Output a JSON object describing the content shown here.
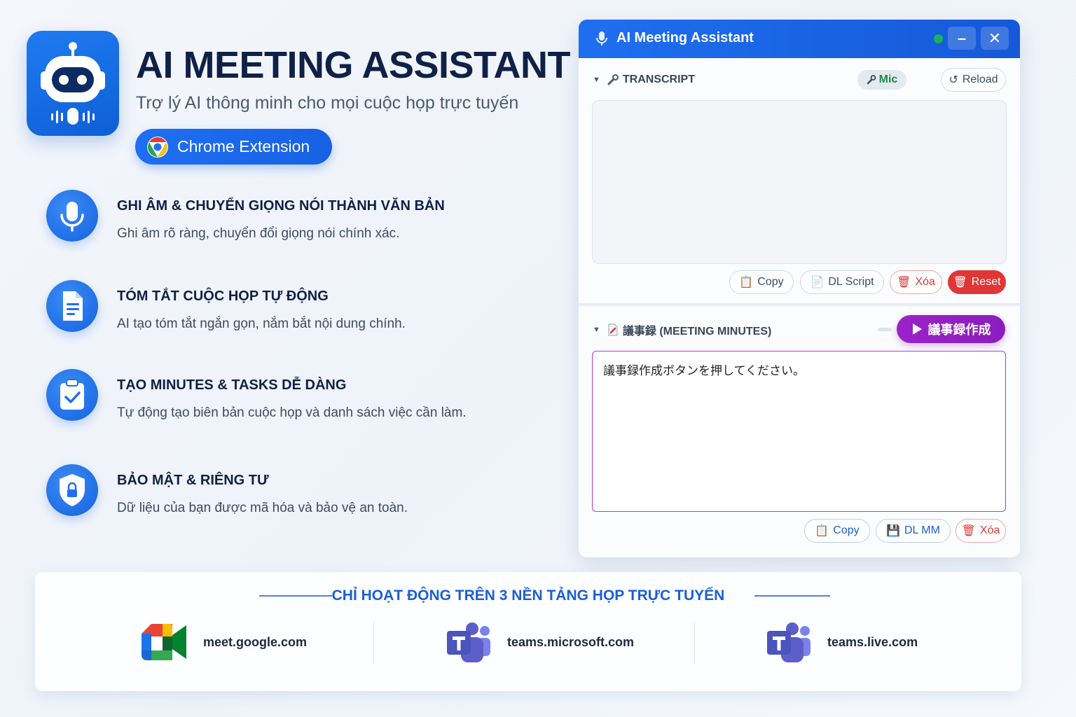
{
  "header": {
    "title": "AI MEETING ASSISTANT",
    "subtitle": "Trợ lý AI thông minh cho mọi cuộc họp trực tuyến",
    "badge_label": "Chrome Extension",
    "logo_icon": "robot-icon",
    "badge_icon": "chrome-icon"
  },
  "features": [
    {
      "icon": "microphone-icon",
      "title": "GHI ÂM & CHUYỂN GIỌNG NÓI THÀNH VĂN BẢN",
      "desc": "Ghi âm rõ ràng, chuyển đổi giọng nói chính xác."
    },
    {
      "icon": "document-icon",
      "title": "TÓM TẮT CUỘC HỌP TỰ ĐỘNG",
      "desc": "AI tạo tóm tắt ngắn gọn, nắm bắt nội dung chính."
    },
    {
      "icon": "clipboard-check-icon",
      "title": "TẠO MINUTES & TASKS DỄ DÀNG",
      "desc": "Tự động tạo biên bản cuộc họp và danh sách việc cần làm."
    },
    {
      "icon": "shield-lock-icon",
      "title": "BẢO MẬT & RIÊNG TƯ",
      "desc": "Dữ liệu của bạn được mã hóa và bảo vệ an toàn."
    }
  ],
  "extension": {
    "title": "AI Meeting Assistant",
    "minimize_label": "–",
    "close_label": "✕",
    "transcript": {
      "title": "TRANSCRIPT",
      "mic_label": "Mic",
      "reload_label": "Reload",
      "reload_glyph": "↺",
      "copy_label": "Copy",
      "dl_label": "DL Script",
      "delete_label": "Xóa",
      "reset_label": "Reset",
      "text": ""
    },
    "minutes": {
      "title": "議事録 (MEETING MINUTES)",
      "generate_label": "議事録作成",
      "placeholder": "議事録作成ボタンを押してください。",
      "copy_label": "Copy",
      "dl_label": "DL MM",
      "delete_label": "Xóa"
    },
    "colors": {
      "accent": "#1e6ff0",
      "purple": "#9a22c9",
      "danger": "#e03636",
      "status": "#19b25b"
    }
  },
  "platforms": {
    "heading": "CHỈ HOẠT ĐỘNG TRÊN 3 NỀN TẢNG HỌP TRỰC TUYẾN",
    "items": [
      {
        "icon": "google-meet-icon",
        "name": "meet.google.com"
      },
      {
        "icon": "microsoft-teams-icon",
        "name": "teams.microsoft.com"
      },
      {
        "icon": "microsoft-teams-icon",
        "name": "teams.live.com"
      }
    ]
  }
}
